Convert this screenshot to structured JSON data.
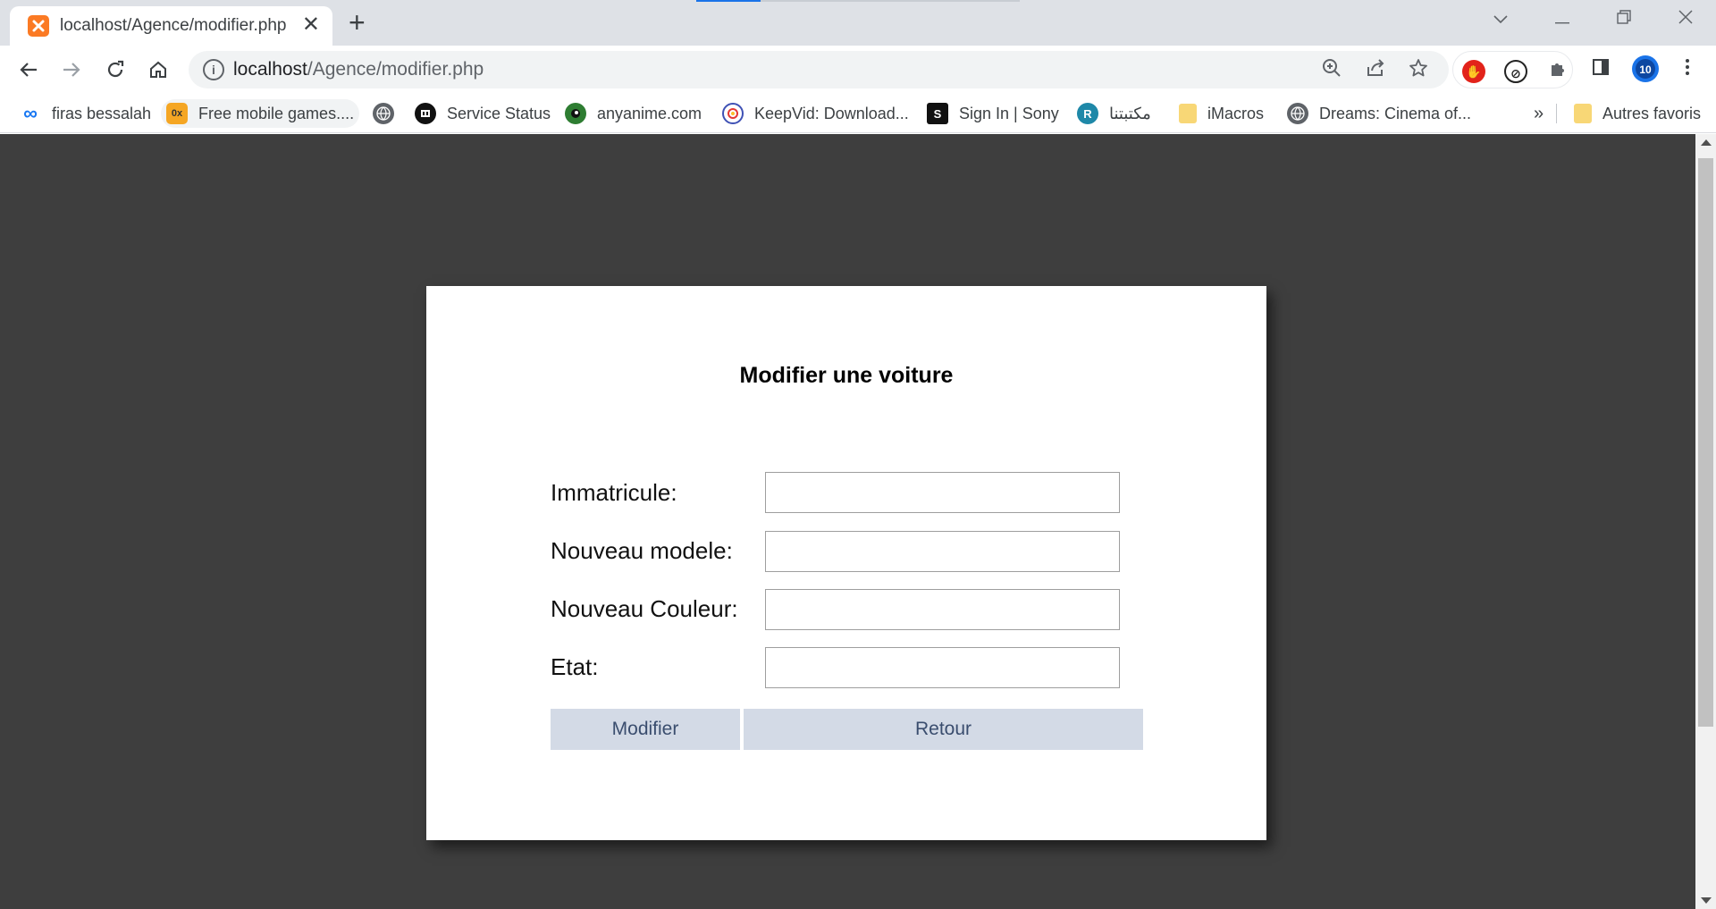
{
  "browser": {
    "tab": {
      "title": "localhost/Agence/modifier.php",
      "favicon": "xampp-icon",
      "close": "✕"
    },
    "new_tab": "+",
    "window_controls": {
      "chevron": "⌄",
      "minimize": "—",
      "restore": "❐",
      "close": "✕"
    },
    "url": {
      "host": "localhost",
      "path": "/Agence/modifier.php"
    },
    "bookmarks": [
      {
        "label": "firas bessalah",
        "icon": "meta-icon",
        "color": "#1877f2",
        "glyph": "∞"
      },
      {
        "label": "Free mobile games....",
        "icon": "games-icon",
        "color": "#f5a623",
        "glyph": "0x"
      },
      {
        "label": "",
        "icon": "globe-icon",
        "color": "#5f6368",
        "glyph": "◍"
      },
      {
        "label": "Service Status",
        "icon": "service-status-icon",
        "color": "#111111",
        "glyph": "■"
      },
      {
        "label": "anyanime.com",
        "icon": "anyanime-icon",
        "color": "#2e7d32",
        "glyph": "●"
      },
      {
        "label": "KeepVid: Download...",
        "icon": "keepvid-icon",
        "color": "#3f51b5",
        "glyph": "◎"
      },
      {
        "label": "Sign In | Sony",
        "icon": "sony-icon",
        "color": "#111111",
        "glyph": "S"
      },
      {
        "label": "مكتبتنا",
        "icon": "maktabatuna-icon",
        "color": "#1e88a8",
        "glyph": "R"
      },
      {
        "label": "iMacros",
        "icon": "folder-icon",
        "color": "#f8d776",
        "glyph": ""
      },
      {
        "label": "Dreams: Cinema of...",
        "icon": "globe-icon",
        "color": "#5f6368",
        "glyph": "◍"
      }
    ],
    "bookmarks_overflow": "»",
    "other_bookmarks": "Autres favoris"
  },
  "form": {
    "title": "Modifier une voiture",
    "fields": [
      {
        "label": "Immatricule:",
        "value": ""
      },
      {
        "label": "Nouveau modele:",
        "value": ""
      },
      {
        "label": "Nouveau Couleur:",
        "value": ""
      },
      {
        "label": "Etat:",
        "value": ""
      }
    ],
    "submit_label": "Modifier",
    "back_label": "Retour"
  },
  "colors": {
    "page_background": "#3e3e3e",
    "card_background": "#ffffff",
    "button_background": "#d3dae6",
    "button_text": "#3a4d6e"
  }
}
